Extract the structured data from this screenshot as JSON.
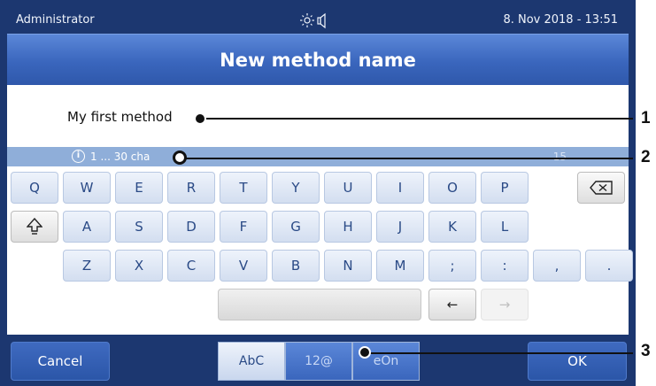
{
  "status": {
    "user": "Administrator",
    "datetime": "8. Nov 2018 - 13:51",
    "icons": [
      "brightness-icon",
      "speaker-icon"
    ]
  },
  "title": "New method name",
  "entry": {
    "value": "My first method"
  },
  "info": {
    "hint": "1 ... 30 cha",
    "counter": "15"
  },
  "keyboard": {
    "row1": [
      "Q",
      "W",
      "E",
      "R",
      "T",
      "Y",
      "U",
      "I",
      "O",
      "P"
    ],
    "row2": [
      "A",
      "S",
      "D",
      "F",
      "G",
      "H",
      "J",
      "K",
      "L"
    ],
    "row3": [
      "Z",
      "X",
      "C",
      "V",
      "B",
      "N",
      "M",
      ";",
      ":",
      ",",
      "."
    ],
    "arrow_left": "←",
    "arrow_right": "→",
    "shift_icon": "shift-icon",
    "backspace_icon": "backspace-icon"
  },
  "bottom": {
    "cancel": "Cancel",
    "modes": [
      "AbC",
      "12@",
      "eOn"
    ],
    "ok": "OK"
  },
  "callouts": [
    "1",
    "2",
    "3"
  ],
  "colors": {
    "frame": "#1c3770",
    "title_blue": "#3a66bd",
    "key_text": "#2a4a86",
    "info_bar": "#8faed9"
  }
}
